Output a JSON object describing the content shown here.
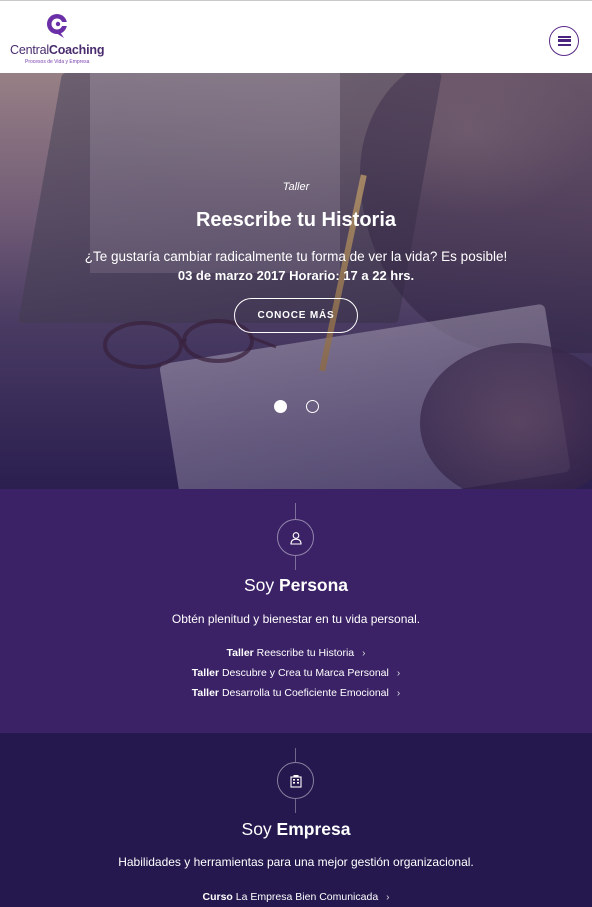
{
  "header": {
    "logo_text_main": "Central",
    "logo_text_bold": "Coaching",
    "logo_tagline": "Procesos de Vida y Empresa",
    "menu_icon": "hamburger-menu-icon"
  },
  "hero": {
    "kicker": "Taller",
    "title": "Reescribe tu Historia",
    "text": "¿Te gustaría cambiar radicalmente tu forma de ver la vida? Es posible!",
    "date": "03 de marzo 2017 Horario: 17 a 22 hrs.",
    "button_label": "CONOCE MÁS",
    "slides": 2,
    "active_slide": 1
  },
  "persona": {
    "icon": "person-icon",
    "title_prefix": "Soy ",
    "title_bold": "Persona",
    "description": "Obtén plenitud y bienestar en tu vida personal.",
    "links": [
      {
        "type": "Taller",
        "label": "Reescribe tu Historia"
      },
      {
        "type": "Taller",
        "label": "Descubre y Crea tu Marca Personal"
      },
      {
        "type": "Taller",
        "label": "Desarrolla tu Coeficiente Emocional"
      }
    ]
  },
  "empresa": {
    "icon": "building-icon",
    "title_prefix": "Soy ",
    "title_bold": "Empresa",
    "description": "Habilidades y herramientas para una mejor gestión organizacional.",
    "links": [
      {
        "type": "Curso",
        "label": "La Empresa Bien Comunicada"
      }
    ]
  },
  "colors": {
    "brand_purple": "#4b2480",
    "persona_bg": "#3b2266",
    "empresa_bg": "#24184e"
  }
}
